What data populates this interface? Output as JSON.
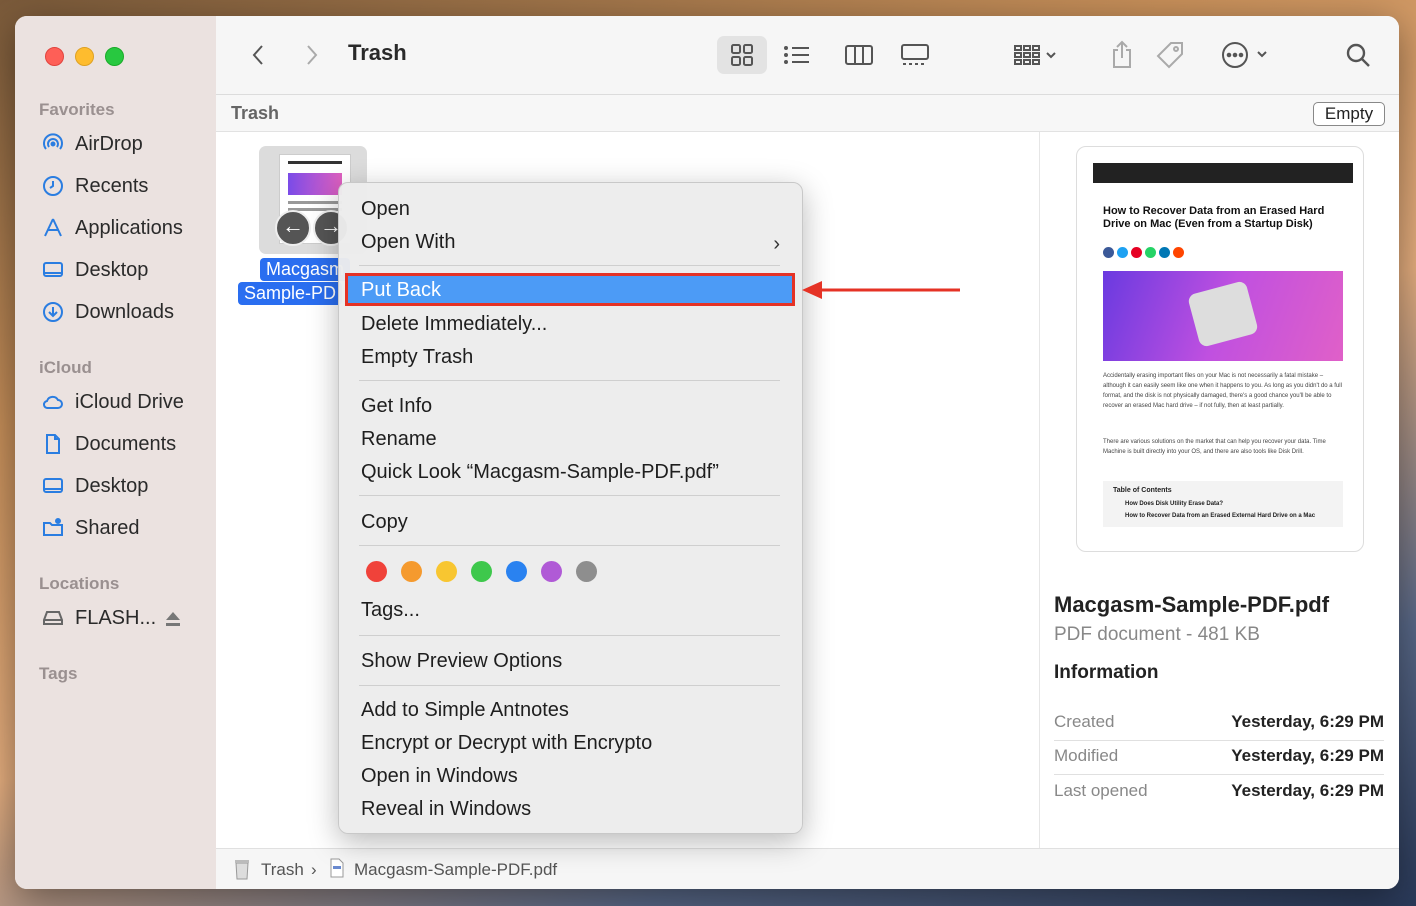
{
  "window": {
    "title": "Trash"
  },
  "sidebar": {
    "favorites_title": "Favorites",
    "favorites": [
      "AirDrop",
      "Recents",
      "Applications",
      "Desktop",
      "Downloads"
    ],
    "icloud_title": "iCloud",
    "icloud": [
      "iCloud Drive",
      "Documents",
      "Desktop",
      "Shared"
    ],
    "locations_title": "Locations",
    "locations": [
      "FLASH..."
    ],
    "tags_title": "Tags"
  },
  "pathbar": {
    "label": "Trash",
    "empty_button": "Empty"
  },
  "file": {
    "name_line1": "Macgasm",
    "name_line2": "Sample-PD"
  },
  "context_menu": {
    "items": {
      "open": "Open",
      "open_with": "Open With",
      "put_back": "Put Back",
      "delete_immediately": "Delete Immediately...",
      "empty_trash": "Empty Trash",
      "get_info": "Get Info",
      "rename": "Rename",
      "quick_look": "Quick Look “Macgasm-Sample-PDF.pdf”",
      "copy": "Copy",
      "tags": "Tags...",
      "show_preview_options": "Show Preview Options",
      "add_simple_antnotes": "Add to Simple Antnotes",
      "encrypt_decrypt": "Encrypt or Decrypt with Encrypto",
      "open_in_windows": "Open in Windows",
      "reveal_in_windows": "Reveal in Windows"
    },
    "tag_colors": [
      "#f0423a",
      "#f59a2e",
      "#f8c631",
      "#3ec84c",
      "#2a82f0",
      "#b05ad6",
      "#8e8e8e"
    ]
  },
  "preview": {
    "doc_heading": "How to Recover Data from an Erased Hard Drive on Mac (Even from a Startup Disk)",
    "body_1": "Accidentally erasing important files on your Mac is not necessarily a fatal mistake – although it can easily seem like one when it happens to you. As long as you didn't do a full format, and the disk is not physically damaged, there's a good chance you'll be able to recover an erased Mac hard drive – if not fully, then at least partially.",
    "body_2": "There are various solutions on the market that can help you recover your data. Time Machine is built directly into your OS, and there are also tools like Disk Drill.",
    "toc_title": "Table of Contents",
    "toc_1": "How Does Disk Utility Erase Data?",
    "toc_2": "How to Recover Data from an Erased External Hard Drive on a Mac",
    "name": "Macgasm-Sample-PDF.pdf",
    "kind": "PDF document - 481 KB",
    "info_title": "Information",
    "rows": [
      {
        "k": "Created",
        "v": "Yesterday, 6:29 PM"
      },
      {
        "k": "Modified",
        "v": "Yesterday, 6:29 PM"
      },
      {
        "k": "Last opened",
        "v": "Yesterday, 6:29 PM"
      }
    ]
  },
  "statusbar": {
    "crumb_1": "Trash",
    "crumb_2": "Macgasm-Sample-PDF.pdf"
  }
}
